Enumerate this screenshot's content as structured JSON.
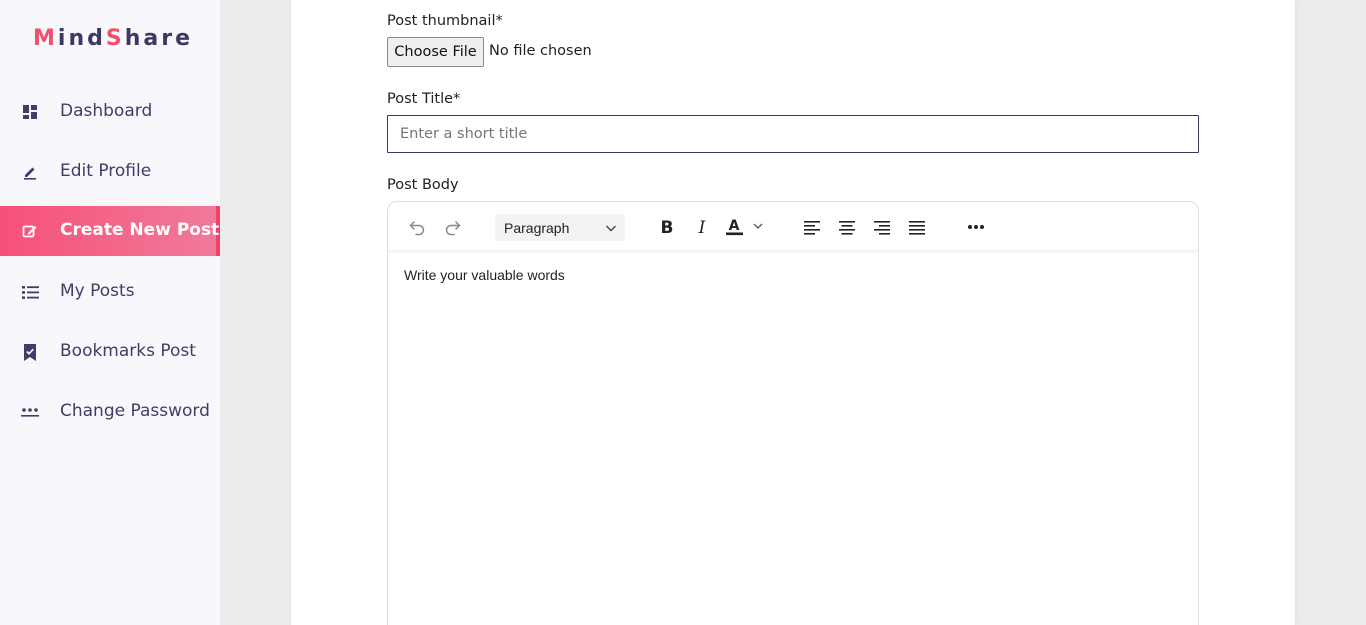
{
  "app": {
    "logo_parts": [
      "M",
      "ind",
      "S",
      "hare"
    ],
    "accent_color": "#f0506e"
  },
  "sidebar": {
    "items": [
      {
        "label": "Dashboard",
        "icon": "dashboard-icon",
        "active": false
      },
      {
        "label": "Edit Profile",
        "icon": "pencil-icon",
        "active": false
      },
      {
        "label": "Create New Post",
        "icon": "edit-square-icon",
        "active": true
      },
      {
        "label": "My Posts",
        "icon": "list-icon",
        "active": false
      },
      {
        "label": "Bookmarks Post",
        "icon": "bookmark-icon",
        "active": false
      },
      {
        "label": "Change Password",
        "icon": "password-dots-icon",
        "active": false
      }
    ]
  },
  "form": {
    "thumbnail_label": "Post thumbnail*",
    "choose_file_label": "Choose File",
    "file_status": "No file chosen",
    "title_label": "Post Title*",
    "title_value": "",
    "title_placeholder": "Enter a short title",
    "body_label": "Post Body"
  },
  "editor": {
    "toolbar": {
      "block_format": "Paragraph",
      "icons": [
        "undo-icon",
        "redo-icon",
        "bold-icon",
        "italic-icon",
        "text-color-icon",
        "align-left-icon",
        "align-center-icon",
        "align-right-icon",
        "justify-icon",
        "more-icon"
      ]
    },
    "body_text": "Write your valuable words"
  }
}
